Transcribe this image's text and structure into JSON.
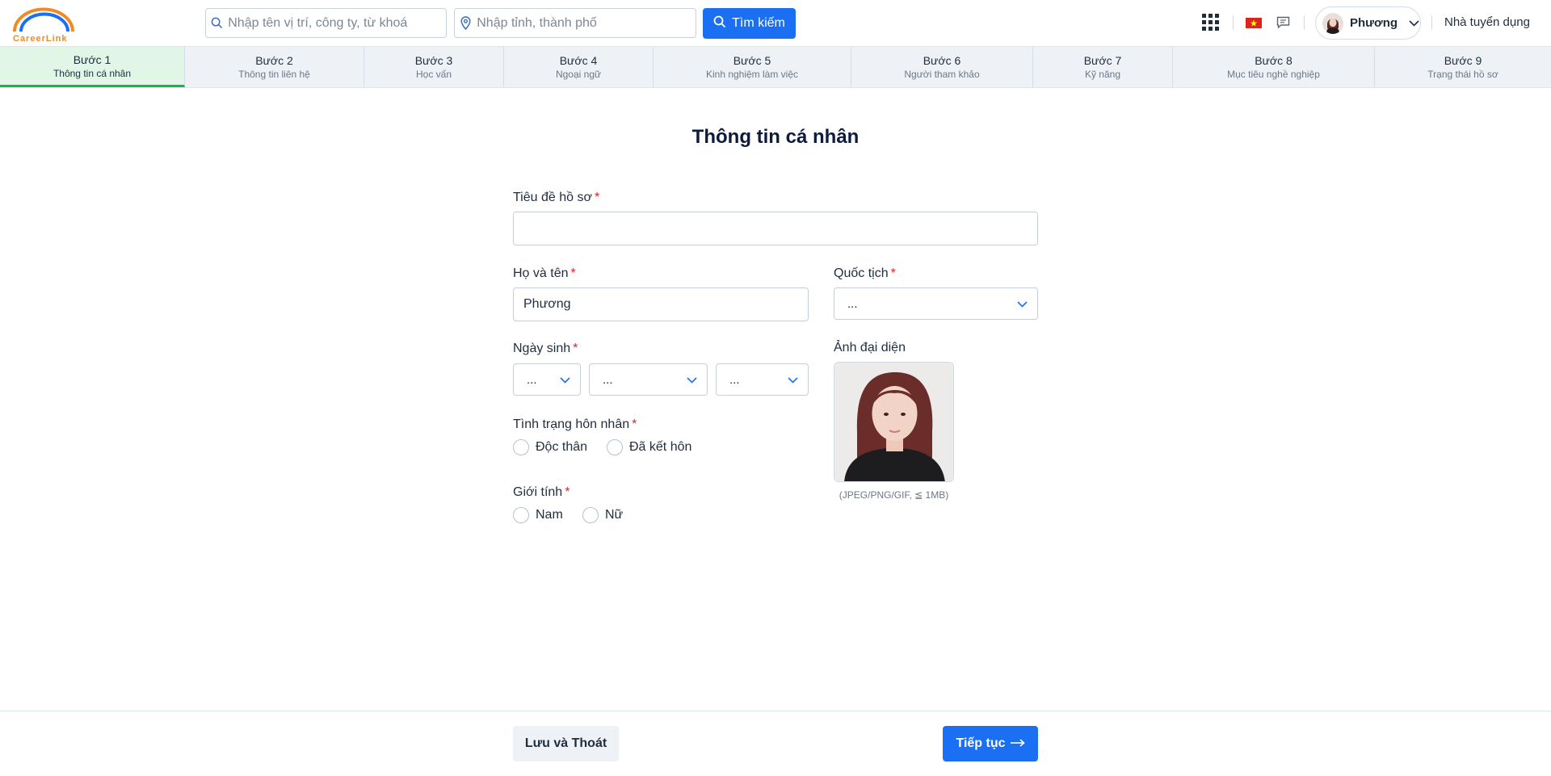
{
  "header": {
    "logo_text": "CareerLink",
    "search_placeholder": "Nhập tên vị trí, công ty, từ khoá",
    "location_placeholder": "Nhập tỉnh, thành phố",
    "search_button": "Tìm kiếm",
    "user_name": "Phương",
    "employer_link": "Nhà tuyển dụng"
  },
  "steps": [
    {
      "num": "Bước 1",
      "name": "Thông tin cá nhân",
      "active": true
    },
    {
      "num": "Bước 2",
      "name": "Thông tin liên hệ"
    },
    {
      "num": "Bước 3",
      "name": "Học vấn"
    },
    {
      "num": "Bước 4",
      "name": "Ngoại ngữ"
    },
    {
      "num": "Bước 5",
      "name": "Kinh nghiệm làm việc"
    },
    {
      "num": "Bước 6",
      "name": "Người tham khảo"
    },
    {
      "num": "Bước 7",
      "name": "Kỹ năng"
    },
    {
      "num": "Bước 8",
      "name": "Mục tiêu nghề nghiệp"
    },
    {
      "num": "Bước 9",
      "name": "Trạng thái hồ sơ"
    }
  ],
  "form": {
    "title": "Thông tin cá nhân",
    "profile_title_label": "Tiêu đề hồ sơ",
    "profile_title_value": "",
    "full_name_label": "Họ và tên",
    "full_name_value": "Phương",
    "nationality_label": "Quốc tịch",
    "nationality_value": "...",
    "dob_label": "Ngày sinh",
    "dob_day": "...",
    "dob_month": "...",
    "dob_year": "...",
    "avatar_label": "Ảnh đại diện",
    "avatar_note": "(JPEG/PNG/GIF, ≦ 1MB)",
    "marital_label": "Tình trạng hôn nhân",
    "marital_options": [
      "Độc thân",
      "Đã kết hôn"
    ],
    "gender_label": "Giới tính",
    "gender_options": [
      "Nam",
      "Nữ"
    ],
    "required_mark": "*"
  },
  "footer": {
    "save_button": "Lưu và Thoát",
    "next_button": "Tiếp tục"
  },
  "colors": {
    "primary": "#1a6ff2",
    "active_step_bg": "#e2f6e7",
    "active_step_border": "#1fae4c",
    "required": "#e02424"
  }
}
